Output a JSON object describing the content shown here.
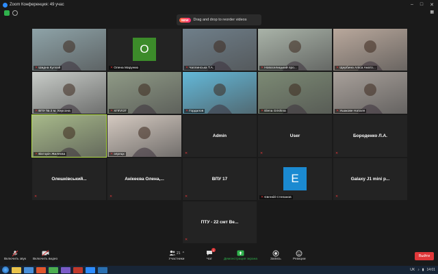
{
  "window": {
    "title": "Zoom Конференция: 49 учас"
  },
  "banner": {
    "badge": "NEW",
    "text": "Drag and drop to reorder videos"
  },
  "tiles": [
    {
      "name": "Шидна Кулозй",
      "kind": "video",
      "color": "#8ea3a8"
    },
    {
      "name": "Олена Марункю",
      "kind": "avatar",
      "initial": "O",
      "color": "#3c8b2a"
    },
    {
      "name": "Чаплинська Т.А.",
      "kind": "video",
      "color": "#6f7f8a"
    },
    {
      "name": "Новоселицький про...",
      "kind": "video",
      "color": "#a9b3a8"
    },
    {
      "name": "Щербина Аліса Анато...",
      "kind": "video",
      "color": "#b9a89c"
    },
    {
      "name": "ВПУ № 2 м. Херсона",
      "kind": "video",
      "color": "#c8ccc8"
    },
    {
      "name": "ХППЛЗТ",
      "kind": "video",
      "color": "#8f9a86"
    },
    {
      "name": "Гордалов",
      "kind": "video",
      "color": "#63b8d8"
    },
    {
      "name": "Elena Grishina",
      "kind": "video",
      "color": "#7c8a74"
    },
    {
      "name": "Ушакове Наталя",
      "kind": "video",
      "color": "#a8a09a"
    },
    {
      "name": "Вікторія Жиляєва",
      "kind": "video",
      "color": "#a7b98a",
      "active": true
    },
    {
      "name": "элрлцх",
      "kind": "video",
      "color": "#d4c9c0"
    },
    {
      "name": "Admin",
      "kind": "name"
    },
    {
      "name": "User",
      "kind": "name"
    },
    {
      "name": "Бороденко Л.А.",
      "kind": "name"
    },
    {
      "name": "Олешківський...",
      "kind": "name"
    },
    {
      "name": "Анікеєва Олена,...",
      "kind": "name"
    },
    {
      "name": "ВПУ 17",
      "kind": "name"
    },
    {
      "name": "Євгеній Степанов",
      "kind": "avatar",
      "initial": "E",
      "color": "#1b8ad1"
    },
    {
      "name": "Galaxy J1 mini p...",
      "kind": "name"
    },
    {
      "name": "ПТУ - 22 смт Ве...",
      "kind": "name"
    }
  ],
  "toolbar": {
    "unmute": "Включить звук",
    "start_video": "Включить видео",
    "participants": "Участники",
    "participants_count": "21",
    "chat": "Чат",
    "chat_badge": "1",
    "share": "Демонстрация экрана",
    "record": "Запись",
    "reactions": "Реакции",
    "end": "Выйти"
  },
  "taskbar": {
    "lang": "UK",
    "time": "14:01"
  },
  "colors": {
    "accent_green": "#2fb24c",
    "end_red": "#e0383a",
    "active_outline": "#b6e04a"
  }
}
